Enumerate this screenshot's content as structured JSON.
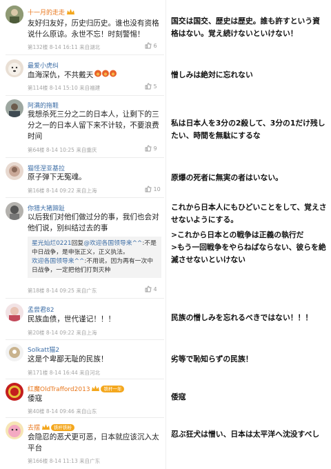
{
  "comments": [
    {
      "user": "十一月的走走",
      "text": "友好归友好，历史归历史。谁也没有资格说什么原谅。永世不忘！时刻警惕！",
      "meta": "第132楼 8-14 16:11 来自湖北",
      "likes": "6",
      "translation": "国交は国交、歴史は歴史。誰も許すという資格はない。覚え続けないといけない！"
    },
    {
      "user": "最爱小虎纠",
      "text": "血海深仇，不共戴天",
      "meta": "第114楼 8-14 15:10 来自福建",
      "likes": "5",
      "translation": "憎しみは絶対に忘れない"
    },
    {
      "user": "阿满的拖鞋",
      "text": "我想杀死三分之二的日本人，让剩下的三分之一的日本人留下来不计较，不要浪费时间",
      "meta": "第64楼 8-14 10:25 来自重庆",
      "likes": "9",
      "translation": "私は日本人を3分の2殺して、3分の1だけ残したい、時間を無駄にするな"
    },
    {
      "user": "猫怪涅亚基拉",
      "text": "原子弹下无冤魂。",
      "meta": "第16楼 8-14 09:22 来自上海",
      "likes": "10",
      "translation": "原爆の死者に無実の者はいない。"
    },
    {
      "user": "你猎大猪蹄趾",
      "text": "以后我们对他们做过分的事，我们也会对他们说，别纠结过去的事",
      "reply": {
        "line1_user": "星光灿烂0221",
        "line1_reply": "回复",
        "line1_at": "@欢迎各国领导来^^",
        "line1_text": ":不是中日战争，是申张正义，正义执法。",
        "line2_user": "欢迎各国领导来^^",
        "line2_text": ":不用说，因为再有一次中日战争，一定把他们打到灭种"
      },
      "meta": "第18楼 8-14 09:25 来自广东",
      "likes": "4",
      "translation_lines": [
        "これから日本人にもひどいことをして、覚えさせないようにする。",
        ">これから日本との戦争は正義の執行だ",
        ">もう一回戦争をやらねばならない、彼らを絶滅させないといけない"
      ]
    },
    {
      "user": "孟尝君82",
      "text": "民族血债，世代谨记！！！",
      "meta": "第20楼 8-14 09:22 来自上海",
      "likes": "",
      "translation": "民族の憎しみを忘れるべきではない！！！"
    },
    {
      "user": "Solkatt猫2",
      "text": "这是个卑鄙无耻的民族！",
      "meta": "第171楼 8-14 16:44 来自河北",
      "likes": "",
      "translation": "劣等で恥知らずの民族！"
    },
    {
      "user": "红魔OldTrafford2013",
      "badge": "铁杆一年",
      "text": "倭寇",
      "meta": "第40楼 8-14 09:46 来自山东",
      "likes": "",
      "translation": "倭寇"
    },
    {
      "user": "去摆",
      "badge": "铁杆铁粉",
      "text": "会隐忍的恶犬更可恶，日本就应该沉入太平台",
      "meta": "第166楼 8-14 11:13 来自广东",
      "likes": "",
      "translation": "忍ぶ狂犬は憎い、日本は太平洋へ沈没すべし"
    }
  ],
  "colors": {
    "username": "#3d6ea6",
    "vip_username": "#e8761b",
    "meta": "#a5a5a5",
    "crown": "#f4a71d"
  },
  "icons": [
    "thumbs-up-icon",
    "crown-icon"
  ]
}
